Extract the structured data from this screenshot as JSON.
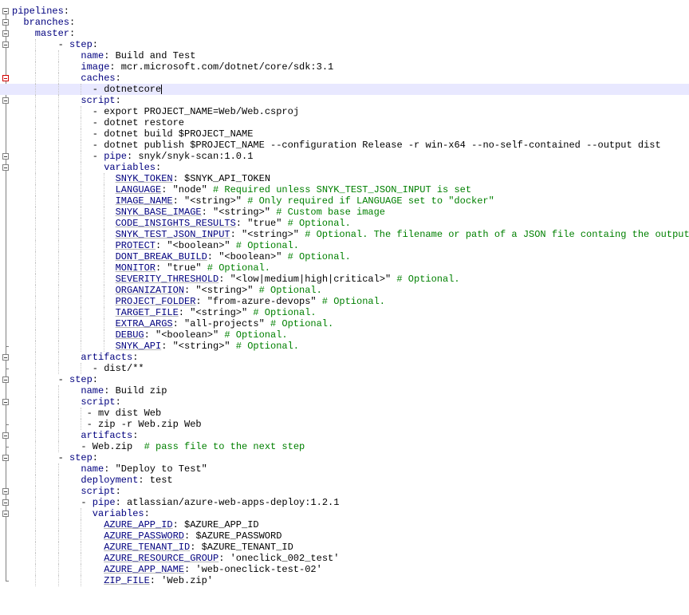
{
  "editor": {
    "current_line": 8,
    "caret_after_line": 8,
    "lines": [
      {
        "indent": 0,
        "segs": [
          [
            "k",
            "pipelines"
          ],
          [
            "p",
            ":"
          ]
        ],
        "fold": "open"
      },
      {
        "indent": 2,
        "segs": [
          [
            "k",
            "branches"
          ],
          [
            "p",
            ":"
          ]
        ],
        "fold": "open"
      },
      {
        "indent": 4,
        "segs": [
          [
            "k",
            "master"
          ],
          [
            "p",
            ":"
          ]
        ],
        "fold": "open"
      },
      {
        "indent": 8,
        "segs": [
          [
            "p",
            "- "
          ],
          [
            "k",
            "step"
          ],
          [
            "p",
            ":"
          ]
        ],
        "fold": "open"
      },
      {
        "indent": 12,
        "segs": [
          [
            "k",
            "name"
          ],
          [
            "p",
            ": "
          ],
          [
            "v",
            "Build and Test"
          ]
        ],
        "fold": "line"
      },
      {
        "indent": 12,
        "segs": [
          [
            "k",
            "image"
          ],
          [
            "p",
            ": "
          ],
          [
            "v",
            "mcr.microsoft.com/dotnet/core/sdk:3.1"
          ]
        ],
        "fold": "line"
      },
      {
        "indent": 12,
        "segs": [
          [
            "k",
            "caches"
          ],
          [
            "p",
            ":"
          ]
        ],
        "fold": "open-red"
      },
      {
        "indent": 14,
        "segs": [
          [
            "p",
            "- "
          ],
          [
            "v",
            "dotnetcore"
          ]
        ],
        "fold": "end-red"
      },
      {
        "indent": 12,
        "segs": [
          [
            "k",
            "script"
          ],
          [
            "p",
            ":"
          ]
        ],
        "fold": "open"
      },
      {
        "indent": 14,
        "segs": [
          [
            "p",
            "- "
          ],
          [
            "v",
            "export PROJECT_NAME=Web/Web.csproj"
          ]
        ],
        "fold": "line"
      },
      {
        "indent": 14,
        "segs": [
          [
            "p",
            "- "
          ],
          [
            "v",
            "dotnet restore"
          ]
        ],
        "fold": "line"
      },
      {
        "indent": 14,
        "segs": [
          [
            "p",
            "- "
          ],
          [
            "v",
            "dotnet build $PROJECT_NAME"
          ]
        ],
        "fold": "line"
      },
      {
        "indent": 14,
        "segs": [
          [
            "p",
            "- "
          ],
          [
            "v",
            "dotnet publish $PROJECT_NAME --configuration Release -r win-x64 --no-self-contained --output dist"
          ]
        ],
        "fold": "line"
      },
      {
        "indent": 14,
        "segs": [
          [
            "p",
            "- "
          ],
          [
            "k",
            "pipe"
          ],
          [
            "p",
            ": "
          ],
          [
            "v",
            "snyk/snyk-scan:1.0.1"
          ]
        ],
        "fold": "open"
      },
      {
        "indent": 16,
        "segs": [
          [
            "k",
            "variables"
          ],
          [
            "p",
            ":"
          ]
        ],
        "fold": "open"
      },
      {
        "indent": 18,
        "segs": [
          [
            "k",
            "SNYK_TOKEN"
          ],
          [
            "p",
            ": "
          ],
          [
            "v",
            "$SNYK_API_TOKEN"
          ]
        ],
        "fold": "line"
      },
      {
        "indent": 18,
        "segs": [
          [
            "k",
            "LANGUAGE"
          ],
          [
            "p",
            ": "
          ],
          [
            "v",
            "\"node\" "
          ],
          [
            "c",
            "# Required unless SNYK_TEST_JSON_INPUT is set"
          ]
        ],
        "fold": "line"
      },
      {
        "indent": 18,
        "segs": [
          [
            "k",
            "IMAGE_NAME"
          ],
          [
            "p",
            ": "
          ],
          [
            "v",
            "\"<string>\" "
          ],
          [
            "c",
            "# Only required if LANGUAGE set to \"docker\""
          ]
        ],
        "fold": "line"
      },
      {
        "indent": 18,
        "segs": [
          [
            "k",
            "SNYK_BASE_IMAGE"
          ],
          [
            "p",
            ": "
          ],
          [
            "v",
            "\"<string>\" "
          ],
          [
            "c",
            "# Custom base image"
          ]
        ],
        "fold": "line"
      },
      {
        "indent": 18,
        "segs": [
          [
            "k",
            "CODE_INSIGHTS_RESULTS"
          ],
          [
            "p",
            ": "
          ],
          [
            "v",
            "\"true\" "
          ],
          [
            "c",
            "# Optional."
          ]
        ],
        "fold": "line"
      },
      {
        "indent": 18,
        "segs": [
          [
            "k",
            "SNYK_TEST_JSON_INPUT"
          ],
          [
            "p",
            ": "
          ],
          [
            "v",
            "\"<string>\" "
          ],
          [
            "c",
            "# Optional. The filename or path of a JSON file containg the output"
          ]
        ],
        "fold": "line"
      },
      {
        "indent": 18,
        "segs": [
          [
            "k",
            "PROTECT"
          ],
          [
            "p",
            ": "
          ],
          [
            "v",
            "\"<boolean>\" "
          ],
          [
            "c",
            "# Optional."
          ]
        ],
        "fold": "line"
      },
      {
        "indent": 18,
        "segs": [
          [
            "k",
            "DONT_BREAK_BUILD"
          ],
          [
            "p",
            ": "
          ],
          [
            "v",
            "\"<boolean>\" "
          ],
          [
            "c",
            "# Optional."
          ]
        ],
        "fold": "line"
      },
      {
        "indent": 18,
        "segs": [
          [
            "k",
            "MONITOR"
          ],
          [
            "p",
            ": "
          ],
          [
            "v",
            "\"true\" "
          ],
          [
            "c",
            "# Optional."
          ]
        ],
        "fold": "line"
      },
      {
        "indent": 18,
        "segs": [
          [
            "k",
            "SEVERITY_THRESHOLD"
          ],
          [
            "p",
            ": "
          ],
          [
            "v",
            "\"<low|medium|high|critical>\" "
          ],
          [
            "c",
            "# Optional."
          ]
        ],
        "fold": "line"
      },
      {
        "indent": 18,
        "segs": [
          [
            "k",
            "ORGANIZATION"
          ],
          [
            "p",
            ": "
          ],
          [
            "v",
            "\"<string>\" "
          ],
          [
            "c",
            "# Optional."
          ]
        ],
        "fold": "line"
      },
      {
        "indent": 18,
        "segs": [
          [
            "k",
            "PROJECT_FOLDER"
          ],
          [
            "p",
            ": "
          ],
          [
            "v",
            "\"from-azure-devops\" "
          ],
          [
            "c",
            "# Optional."
          ]
        ],
        "fold": "line"
      },
      {
        "indent": 18,
        "segs": [
          [
            "k",
            "TARGET_FILE"
          ],
          [
            "p",
            ": "
          ],
          [
            "v",
            "\"<string>\" "
          ],
          [
            "c",
            "# Optional."
          ]
        ],
        "fold": "line"
      },
      {
        "indent": 18,
        "segs": [
          [
            "k",
            "EXTRA_ARGS"
          ],
          [
            "p",
            ": "
          ],
          [
            "v",
            "\"all-projects\" "
          ],
          [
            "c",
            "# Optional."
          ]
        ],
        "fold": "line"
      },
      {
        "indent": 18,
        "segs": [
          [
            "k",
            "DEBUG"
          ],
          [
            "p",
            ": "
          ],
          [
            "v",
            "\"<boolean>\" "
          ],
          [
            "c",
            "# Optional."
          ]
        ],
        "fold": "line"
      },
      {
        "indent": 18,
        "segs": [
          [
            "k",
            "SNYK_API"
          ],
          [
            "p",
            ": "
          ],
          [
            "v",
            "\"<string>\" "
          ],
          [
            "c",
            "# Optional."
          ]
        ],
        "fold": "end"
      },
      {
        "indent": 12,
        "segs": [
          [
            "k",
            "artifacts"
          ],
          [
            "p",
            ":"
          ]
        ],
        "fold": "open"
      },
      {
        "indent": 14,
        "segs": [
          [
            "p",
            "- "
          ],
          [
            "v",
            "dist/**"
          ]
        ],
        "fold": "end"
      },
      {
        "indent": 8,
        "segs": [
          [
            "p",
            "- "
          ],
          [
            "k",
            "step"
          ],
          [
            "p",
            ":"
          ]
        ],
        "fold": "open"
      },
      {
        "indent": 12,
        "segs": [
          [
            "k",
            "name"
          ],
          [
            "p",
            ": "
          ],
          [
            "v",
            "Build zip"
          ]
        ],
        "fold": "line"
      },
      {
        "indent": 12,
        "segs": [
          [
            "k",
            "script"
          ],
          [
            "p",
            ":"
          ]
        ],
        "fold": "open"
      },
      {
        "indent": 13,
        "segs": [
          [
            "p",
            "- "
          ],
          [
            "v",
            "mv dist Web"
          ]
        ],
        "fold": "line"
      },
      {
        "indent": 13,
        "segs": [
          [
            "p",
            "- "
          ],
          [
            "v",
            "zip -r Web.zip Web"
          ]
        ],
        "fold": "end"
      },
      {
        "indent": 12,
        "segs": [
          [
            "k",
            "artifacts"
          ],
          [
            "p",
            ":"
          ]
        ],
        "fold": "open"
      },
      {
        "indent": 12,
        "segs": [
          [
            "p",
            "- "
          ],
          [
            "v",
            "Web.zip  "
          ],
          [
            "c",
            "# pass file to the next step"
          ]
        ],
        "fold": "end"
      },
      {
        "indent": 8,
        "segs": [
          [
            "p",
            "- "
          ],
          [
            "k",
            "step"
          ],
          [
            "p",
            ":"
          ]
        ],
        "fold": "open"
      },
      {
        "indent": 12,
        "segs": [
          [
            "k",
            "name"
          ],
          [
            "p",
            ": "
          ],
          [
            "v",
            "\"Deploy to Test\""
          ]
        ],
        "fold": "line"
      },
      {
        "indent": 12,
        "segs": [
          [
            "k",
            "deployment"
          ],
          [
            "p",
            ": "
          ],
          [
            "v",
            "test"
          ]
        ],
        "fold": "line"
      },
      {
        "indent": 12,
        "segs": [
          [
            "k",
            "script"
          ],
          [
            "p",
            ":"
          ]
        ],
        "fold": "open"
      },
      {
        "indent": 12,
        "segs": [
          [
            "p",
            "- "
          ],
          [
            "k",
            "pipe"
          ],
          [
            "p",
            ": "
          ],
          [
            "v",
            "atlassian/azure-web-apps-deploy:1.2.1"
          ]
        ],
        "fold": "open"
      },
      {
        "indent": 14,
        "segs": [
          [
            "k",
            "variables"
          ],
          [
            "p",
            ":"
          ]
        ],
        "fold": "open"
      },
      {
        "indent": 16,
        "segs": [
          [
            "k",
            "AZURE_APP_ID"
          ],
          [
            "p",
            ": "
          ],
          [
            "v",
            "$AZURE_APP_ID"
          ]
        ],
        "fold": "line"
      },
      {
        "indent": 16,
        "segs": [
          [
            "k",
            "AZURE_PASSWORD"
          ],
          [
            "p",
            ": "
          ],
          [
            "v",
            "$AZURE_PASSWORD"
          ]
        ],
        "fold": "line"
      },
      {
        "indent": 16,
        "segs": [
          [
            "k",
            "AZURE_TENANT_ID"
          ],
          [
            "p",
            ": "
          ],
          [
            "v",
            "$AZURE_TENANT_ID"
          ]
        ],
        "fold": "line"
      },
      {
        "indent": 16,
        "segs": [
          [
            "k",
            "AZURE_RESOURCE_GROUP"
          ],
          [
            "p",
            ": "
          ],
          [
            "v",
            "'oneclick_002_test'"
          ]
        ],
        "fold": "line"
      },
      {
        "indent": 16,
        "segs": [
          [
            "k",
            "AZURE_APP_NAME"
          ],
          [
            "p",
            ": "
          ],
          [
            "v",
            "'web-oneclick-test-02'"
          ]
        ],
        "fold": "line"
      },
      {
        "indent": 16,
        "segs": [
          [
            "k",
            "ZIP_FILE"
          ],
          [
            "p",
            ": "
          ],
          [
            "v",
            "'Web.zip'"
          ]
        ],
        "fold": "end"
      }
    ]
  }
}
